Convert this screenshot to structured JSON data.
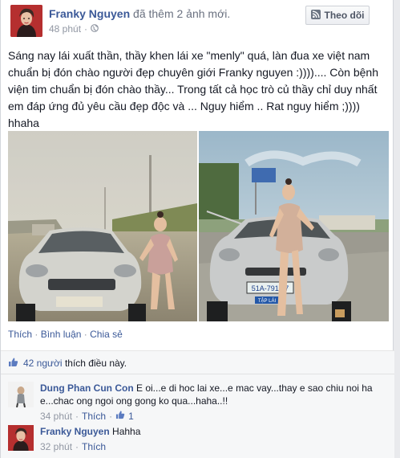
{
  "post": {
    "author": "Franky Nguyen",
    "action": "đã thêm 2 ảnh mới.",
    "time": "48 phút",
    "audience_icon": "globe-icon",
    "follow_label": "Theo dõi",
    "caption": "Sáng nay lái xuất thần, thầy khen lái xe \"menly\" quá, làn đua xe việt nam chuẩn bị đón chào người đẹp chuyên giới Franky nguyen :)))).... Còn bệnh viện tim chuẩn bị đón chào thầy... Trong tất cả học trò củ thầy chỉ duy nhất em đáp ứng đủ yêu cầu đẹp độc và ... Nguy hiểm .. Rat nguy hiểm ;)))) hhaha",
    "actions": {
      "like": "Thích",
      "comment": "Bình luận",
      "share": "Chia sẻ",
      "separator": "·"
    },
    "plate_1": "51A-791.27",
    "plate_2": "TẬP LÁI"
  },
  "likes": {
    "count": "42 người",
    "text": "thích điều này."
  },
  "comments": [
    {
      "author": "Dung Phan Cun Con",
      "text": "E oi...e di hoc lai xe...e mac vay...thay e sao chiu noi ha e...chac ong ngoi ong gong ko qua...haha..!!",
      "time": "34 phút",
      "like": "Thích",
      "like_count": "1"
    },
    {
      "author": "Franky Nguyen",
      "text": "Hahha",
      "time": "32 phút",
      "like": "Thích"
    }
  ],
  "colors": {
    "link": "#3b5998",
    "meta": "#9197a3",
    "background": "#e9eaed"
  }
}
